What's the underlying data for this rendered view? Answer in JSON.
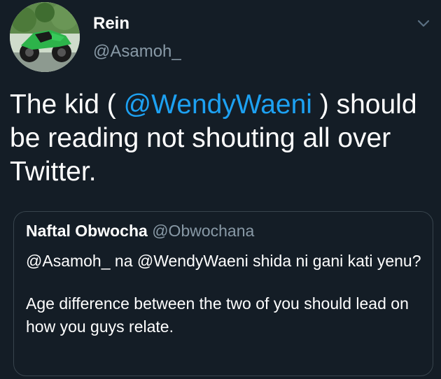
{
  "author": {
    "name": "Rein",
    "handle": "@Asamoh_"
  },
  "tweet": {
    "text_before": "The kid ( ",
    "mention": "@WendyWaeni",
    "text_after": " ) should be reading not shouting all over Twitter."
  },
  "quote": {
    "name": "Naftal Obwocha",
    "handle": "@Obwochana",
    "paragraph_1": "@Asamoh_  na @WendyWaeni shida ni gani kati yenu?",
    "paragraph_2": "Age difference between the two of you  should lead on how you guys relate."
  },
  "icons": {
    "menu": "chevron-down-icon",
    "avatar": "motorcycle-avatar"
  },
  "colors": {
    "background": "#141d26",
    "mention": "#1da1f2",
    "secondary_text": "#8899a6",
    "border": "#38444d"
  }
}
